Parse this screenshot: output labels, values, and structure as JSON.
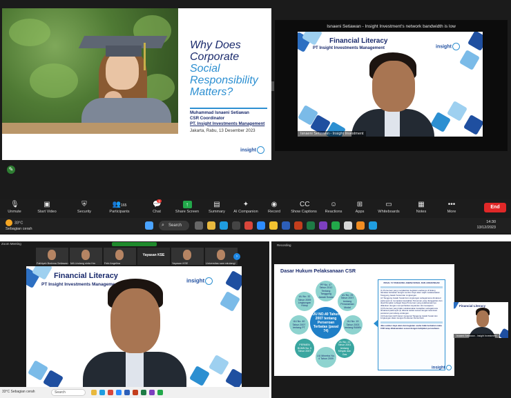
{
  "slide_main": {
    "title_line1": "Why Does",
    "title_line2": "Corporate",
    "title_line3": "Social",
    "title_line4": "Responsibility",
    "title_line5": "Matters?",
    "presenter_name": "Muhammad Isnaeni Setiawan",
    "presenter_role": "CSR Coordinator",
    "presenter_company": "PT. Insight Investments Management",
    "date": "Jakarta, Rabu, 13 Desember 2023",
    "logo": "insight"
  },
  "video_right": {
    "bandwidth_notice": "Isnaeni Setiawan - Insight Investment's network bandwidth is low",
    "banner_title": "Financial Literacy",
    "banner_sub": "PT Insight Investments Management",
    "logo": "insight",
    "name_label": "Isnaeni Setiawan - Insight Investment"
  },
  "toolbar": {
    "unmute": "Unmute",
    "start_video": "Start Video",
    "security": "Security",
    "participants": "Participants",
    "participants_count": "165",
    "chat": "Chat",
    "chat_badge": "1",
    "share_screen": "Share Screen",
    "summary": "Summary",
    "ai_companion": "AI Companion",
    "record": "Record",
    "show_captions": "Show Captions",
    "reactions": "Reactions",
    "apps": "Apps",
    "whiteboards": "Whiteboards",
    "notes": "Notes",
    "more": "More",
    "end": "End"
  },
  "taskbar": {
    "weather_temp": "33°C",
    "weather_desc": "Sebagian cerah",
    "search": "Search",
    "time": "14:30",
    "date": "13/12/2023"
  },
  "bottom_left": {
    "window_title": "Zoom Meeting",
    "thumbs": [
      {
        "name": "Fathiyah Brahma Setiawan"
      },
      {
        "name": "MA Lindang sinta Hm"
      },
      {
        "name": "Febi Angelina"
      },
      {
        "name": "Yayasan KSE",
        "label": true
      },
      {
        "name": "Yayasan KSE"
      },
      {
        "name": "Universitas sam ratulangi"
      }
    ],
    "banner_title": "Financial Literacy",
    "banner_sub": "PT Insight Investments Management",
    "logo": "insight",
    "taskbar_weather": "33°C Sebagian cerah",
    "taskbar_search": "Search"
  },
  "bottom_right": {
    "window_title": "Recording",
    "slide_title": "Dasar Hukum Pelaksanaan CSR",
    "center_circle": "UU NO.40 Tahun 2007 tentang Perseroan Terbatas (pasal 74)",
    "circles": [
      "PP No. 47 Tahun 2012 Tentang Tanggung Jawab Sosial",
      "UU No. 25 Tahun 2007 tentang Penanaman Modal",
      "UU No. 19 Tahun 2003 tentang BUMN",
      "UU No. 22 Tahun 2001 tentang Minyak dan Gas",
      "UU Minerba No. 4 Tahun 2009",
      "PERMEN BUMN No. 5 Tahun 2007",
      "UU No. 40 Tahun 2007 tentang PT",
      "UU No. 32 Tahun 2009 Lingkungan Hidup"
    ],
    "callout_head": "PASAL 74 TANGGUNG JAWAB SOSIAL DAN LINGKUNGAN",
    "callout_lines": [
      "(1) Perseroan yang menjalankan kegiatan usahanya di bidang dan/atau berkaitan dengan sumber daya alam wajib melaksanakan Tanggung Jawab Sosial dan Lingkungan.",
      "(2) Tanggung Jawab Sosial dan Lingkungan sebagaimana dimaksud pada ayat (1) merupakan kewajiban Perseroan yang dianggarkan dan diperhitungkan sebagai biaya Perseroan yang pelaksanaannya dilakukan dengan memperhatikan kepatutan dan kewajaran.",
      "(3) Perseroan yang tidak melaksanakan kewajiban sebagaimana dimaksud pada ayat (1) dikenai sanksi sesuai dengan ketentuan peraturan perundang-undangan.",
      "(4) Ketentuan lebih lanjut mengenai Tanggung Jawab Sosial dan Lingkungan diatur dengan Peraturan Pemerintah."
    ],
    "callout_foot": "Jika sumber daya alam dan kegiatan usaha tidak berkaitan maka CSR tetap dilaksanakan sesuai dengan kebijakan perusahaan.",
    "logo": "insight",
    "mini_banner": "Financial Literacy",
    "mini_name": "Isnaeni Setiawan - Insight Investment"
  },
  "colors": {
    "brand_navy": "#1a2a6c",
    "brand_blue": "#2c8fd1",
    "end_red": "#e02828",
    "share_green": "#22a84a"
  }
}
